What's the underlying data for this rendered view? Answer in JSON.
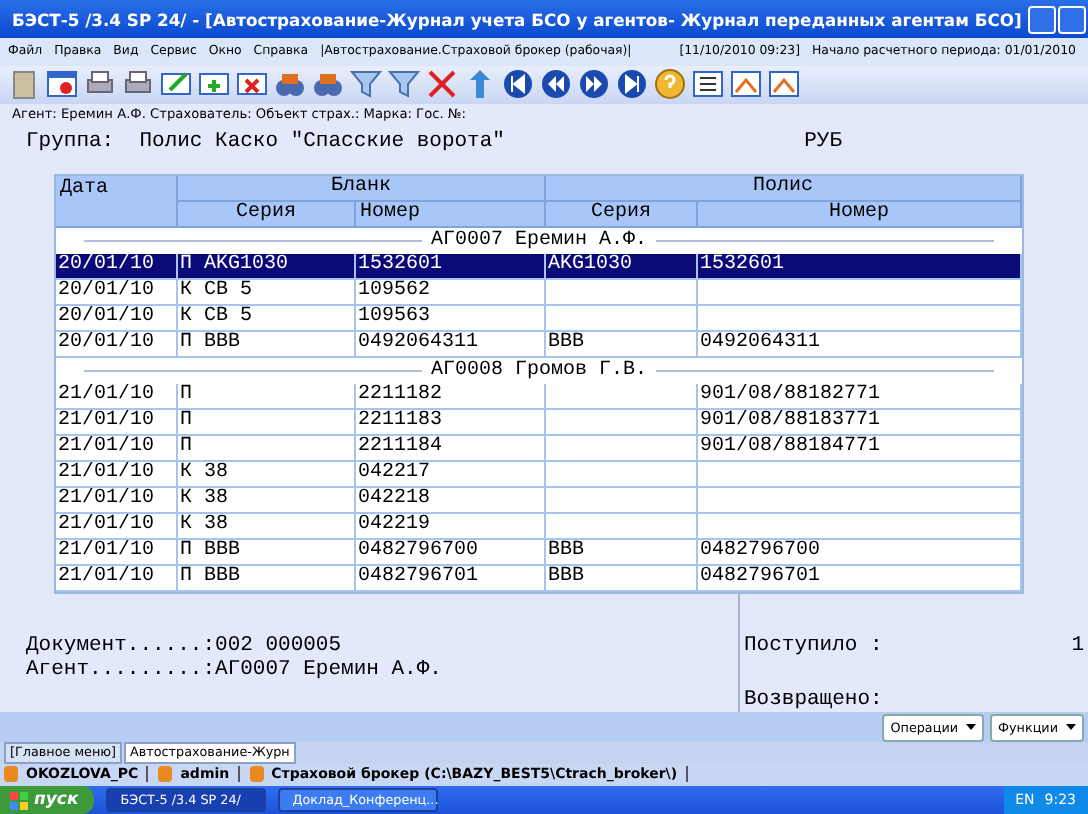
{
  "window": {
    "title": "БЭСТ-5 /3.4 SP 24/ - [Автострахование-Журнал учета БСО у агентов- Журнал переданных агентам БСО]"
  },
  "menu": {
    "items": [
      "Файл",
      "Правка",
      "Вид",
      "Сервис",
      "Окно",
      "Справка"
    ],
    "context": "|Автострахование.Страховой брокер (рабочая)|",
    "datetime": "[11/10/2010 09:23]",
    "period": "Начало расчетного периода: 01/01/2010"
  },
  "filter_line": "Агент: Еремин А.Ф. Страхователь: Объект страх.: Марка: Гос. №:",
  "group_line": {
    "label": "Группа:",
    "value": "Полис Каско \"Спасские ворота\"",
    "currency": "РУБ"
  },
  "table": {
    "columns": {
      "date": "Дата",
      "blank": "Бланк",
      "policy": "Полис",
      "blank_series": "Серия",
      "blank_number": "Номер",
      "policy_series": "Серия",
      "policy_number": "Номер"
    },
    "groups": [
      {
        "title": "АГ0007 Еремин А.Ф.",
        "rows": [
          {
            "date": "20/01/10",
            "blank_series": "П AKG1030",
            "blank_number": "1532601",
            "policy_series": "AKG1030",
            "policy_number": "1532601",
            "selected": true
          },
          {
            "date": "20/01/10",
            "blank_series": "К СВ 5",
            "blank_number": "109562",
            "selected": false
          },
          {
            "date": "20/01/10",
            "blank_series": "К СВ 5",
            "blank_number": "109563",
            "selected": false
          },
          {
            "date": "20/01/10",
            "blank_series": "П ВВВ",
            "blank_number": "0492064311",
            "policy_series": "ВВВ",
            "policy_number": "0492064311",
            "selected": false
          }
        ]
      },
      {
        "title": "АГ0008 Громов Г.В.",
        "rows": [
          {
            "date": "21/01/10",
            "blank_series": "П",
            "blank_number": "2211182",
            "policy_number": "901/08/88182771",
            "selected": false
          },
          {
            "date": "21/01/10",
            "blank_series": "П",
            "blank_number": "2211183",
            "policy_number": "901/08/88183771",
            "selected": false
          },
          {
            "date": "21/01/10",
            "blank_series": "П",
            "blank_number": "2211184",
            "policy_number": "901/08/88184771",
            "selected": false
          },
          {
            "date": "21/01/10",
            "blank_series": "К 38",
            "blank_number": "042217",
            "selected": false
          },
          {
            "date": "21/01/10",
            "blank_series": "К 38",
            "blank_number": "042218",
            "selected": false
          },
          {
            "date": "21/01/10",
            "blank_series": "К 38",
            "blank_number": "042219",
            "selected": false
          },
          {
            "date": "21/01/10",
            "blank_series": "П ВВВ",
            "blank_number": "0482796700",
            "policy_series": "ВВВ",
            "policy_number": "0482796700",
            "selected": false
          },
          {
            "date": "21/01/10",
            "blank_series": "П ВВВ",
            "blank_number": "0482796701",
            "policy_series": "ВВВ",
            "policy_number": "0482796701",
            "selected": false
          }
        ]
      }
    ]
  },
  "details": {
    "document": "Документ......:002 000005",
    "agent": "Агент.........:АГ0007 Еремин А.Ф.",
    "received_label": "Поступило :",
    "received_value": "1",
    "returned_label": "Возвращено:"
  },
  "actions": [
    "Операции",
    "Функции"
  ],
  "tabs": [
    {
      "label": "[Главное меню]",
      "selected": false
    },
    {
      "label": "Автострахование-Журн",
      "selected": true
    }
  ],
  "status_bar": [
    "OKOZLOVA_PC",
    "admin",
    "Страховой брокер (C:\\BAZY_BEST5\\Ctrach_broker\\)"
  ],
  "taskbar": {
    "start": "пуск",
    "windows": [
      {
        "label": "БЭСТ-5 /3.4 SP 24/",
        "selected": true
      },
      {
        "label": "Доклад_Конференц...",
        "selected": false
      }
    ],
    "language": "EN",
    "clock": "9:23"
  }
}
